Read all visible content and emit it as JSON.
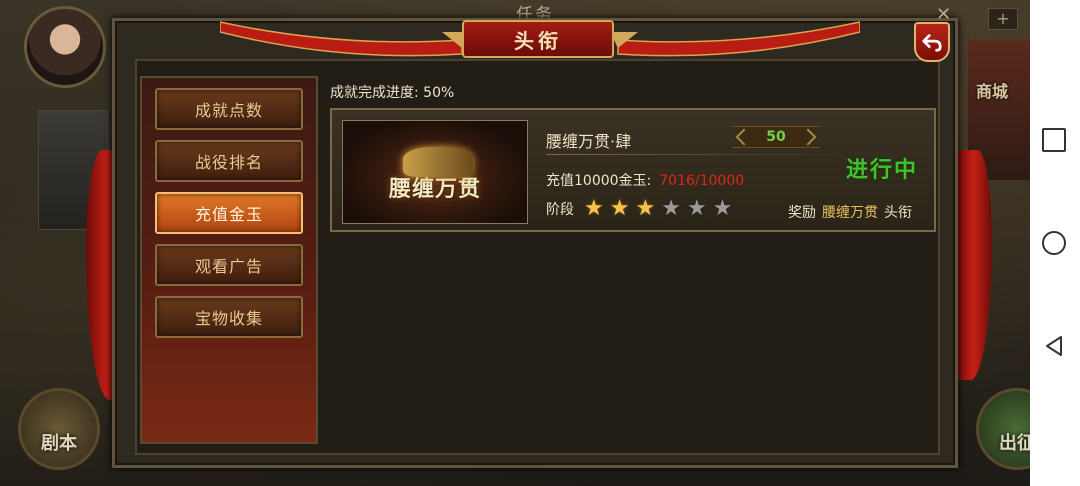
{
  "background": {
    "window_title": "任务",
    "shop_label": "商城",
    "plus_label": "+",
    "left_button_label": "剧本",
    "right_button_label": "出征"
  },
  "panel": {
    "title": "头衔",
    "close_label": "✕"
  },
  "sidebar": {
    "items": [
      {
        "label": "成就点数",
        "active": false
      },
      {
        "label": "战役排名",
        "active": false
      },
      {
        "label": "充值金玉",
        "active": true
      },
      {
        "label": "观看广告",
        "active": false
      },
      {
        "label": "宝物收集",
        "active": false
      }
    ]
  },
  "content": {
    "progress_label": "成就完成进度:",
    "progress_value": "50%",
    "card": {
      "image_text": "腰缠万贯",
      "title": "腰缠万贯·肆",
      "level": "50",
      "task_label": "充值10000金玉:",
      "task_progress": "7016/10000",
      "status": "进行中",
      "stage_label": "阶段",
      "stars_filled": 3,
      "stars_total": 6,
      "reward_label": "奖励",
      "reward_item": "腰缠万贯",
      "reward_type": "头衔"
    }
  },
  "colors": {
    "accent_active": "#e0782a",
    "status_green": "#42c22a",
    "progress_red": "#e0241a",
    "star_gold": "#f2c44a"
  },
  "icons": [
    "back-arrow-icon",
    "close-icon",
    "star-icon",
    "nav-square-icon",
    "nav-circle-icon",
    "nav-back-icon"
  ]
}
